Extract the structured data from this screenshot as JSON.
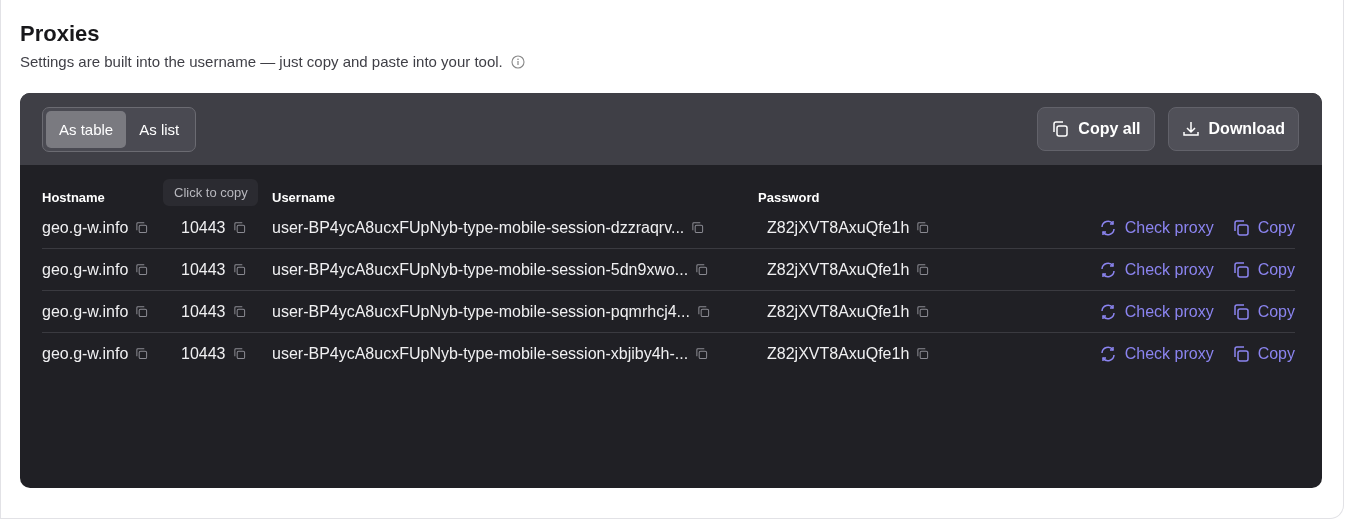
{
  "title": "Proxies",
  "subtitle": "Settings are built into the username — just copy and paste into your tool.",
  "view_tabs": [
    {
      "label": "As table",
      "selected": true
    },
    {
      "label": "As list",
      "selected": false
    }
  ],
  "toolbar_buttons": [
    {
      "label": "Copy all",
      "kind": "copy"
    },
    {
      "label": "Download",
      "kind": "download"
    }
  ],
  "table": {
    "columns": [
      "Hostname",
      "",
      "Username",
      "Password"
    ],
    "tooltip": "Click to copy",
    "rows": [
      {
        "hostname": "geo.g-w.info",
        "port": "10443",
        "username": "user-BP4ycA8ucxFUpNyb-type-mobile-session-dzzraqrv...",
        "password": "Z82jXVT8AxuQfe1h",
        "check": "Check proxy",
        "copy": "Copy"
      },
      {
        "hostname": "geo.g-w.info",
        "port": "10443",
        "username": "user-BP4ycA8ucxFUpNyb-type-mobile-session-5dn9xwo...",
        "password": "Z82jXVT8AxuQfe1h",
        "check": "Check proxy",
        "copy": "Copy"
      },
      {
        "hostname": "geo.g-w.info",
        "port": "10443",
        "username": "user-BP4ycA8ucxFUpNyb-type-mobile-session-pqmrhcj4...",
        "password": "Z82jXVT8AxuQfe1h",
        "check": "Check proxy",
        "copy": "Copy"
      },
      {
        "hostname": "geo.g-w.info",
        "port": "10443",
        "username": "user-BP4ycA8ucxFUpNyb-type-mobile-session-xbjiby4h-...",
        "password": "Z82jXVT8AxuQfe1h",
        "check": "Check proxy",
        "copy": "Copy"
      }
    ]
  }
}
